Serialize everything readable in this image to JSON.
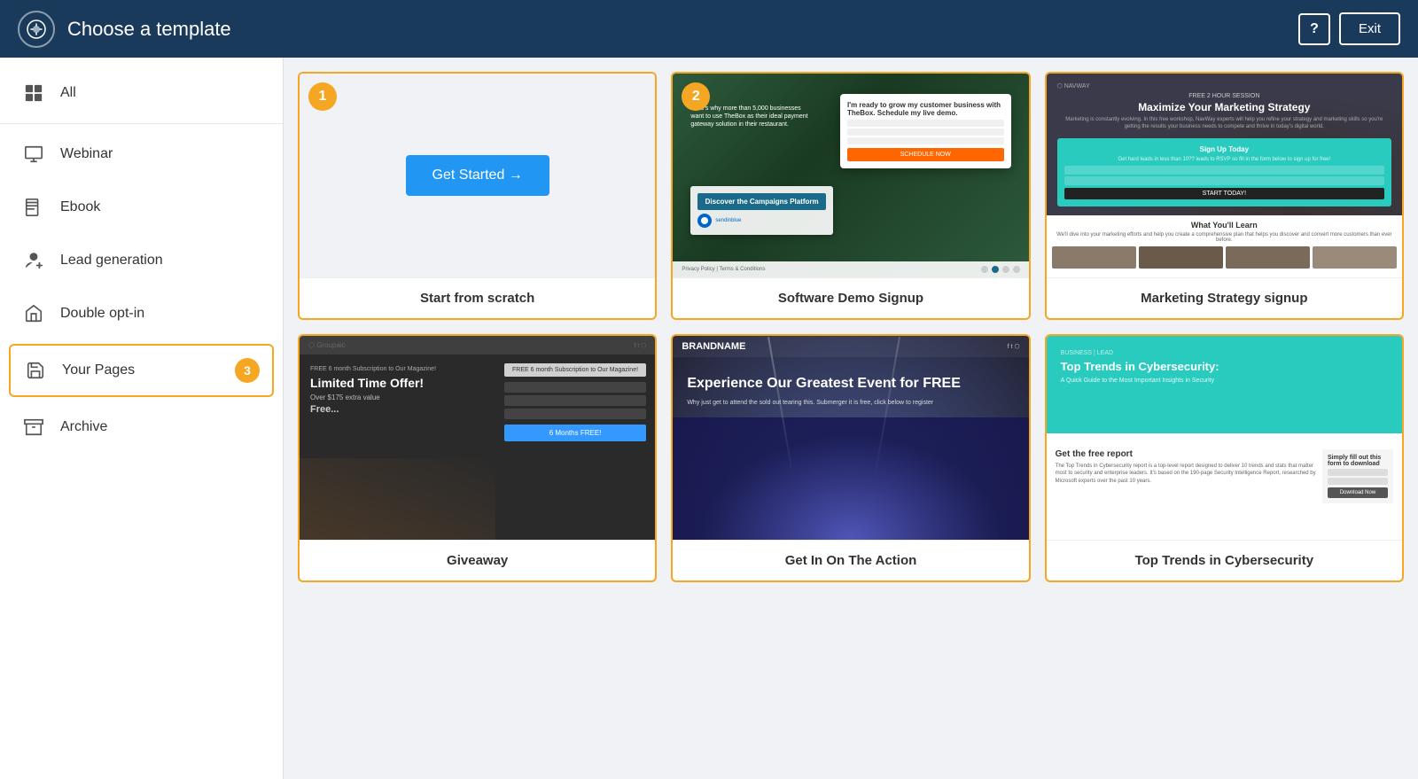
{
  "header": {
    "title": "Choose a template",
    "help_label": "?",
    "exit_label": "Exit",
    "logo_icon": "✦"
  },
  "sidebar": {
    "items": [
      {
        "id": "all",
        "label": "All",
        "icon": "grid",
        "selected": false
      },
      {
        "id": "webinar",
        "label": "Webinar",
        "icon": "monitor",
        "selected": false
      },
      {
        "id": "ebook",
        "label": "Ebook",
        "icon": "book",
        "selected": false
      },
      {
        "id": "lead-generation",
        "label": "Lead generation",
        "icon": "person-add",
        "selected": false
      },
      {
        "id": "double-opt-in",
        "label": "Double opt-in",
        "icon": "inbox",
        "selected": false
      },
      {
        "id": "your-pages",
        "label": "Your Pages",
        "icon": "save",
        "selected": true,
        "badge": "3"
      },
      {
        "id": "archive",
        "label": "Archive",
        "icon": "archive",
        "selected": false
      }
    ]
  },
  "templates": {
    "items": [
      {
        "id": "scratch",
        "label": "Start from scratch",
        "type": "scratch",
        "selected": true,
        "badge": "1",
        "button_label": "Get Started →"
      },
      {
        "id": "software-demo",
        "label": "Software Demo Signup",
        "type": "demo",
        "selected": true,
        "badge": "2"
      },
      {
        "id": "marketing-strategy",
        "label": "Marketing Strategy signup",
        "type": "marketing",
        "selected": true,
        "badge": null
      },
      {
        "id": "giveaway",
        "label": "Giveaway",
        "type": "giveaway",
        "selected": true,
        "badge": null,
        "preview": {
          "offer": "FREE 6 month Subscription to Our Magazine!",
          "title": "Limited Time Offer!",
          "value": "Over $175 extra value",
          "free": "Free..."
        }
      },
      {
        "id": "event",
        "label": "Get In On The Action",
        "type": "event",
        "selected": true,
        "badge": null,
        "preview": {
          "brand": "BRANDNAME",
          "title": "Experience Our Greatest Event for FREE"
        }
      },
      {
        "id": "cybersecurity",
        "label": "Top Trends in Cybersecurity",
        "type": "cyber",
        "selected": true,
        "badge": null,
        "preview": {
          "brand": "BUSINESS | LEAD",
          "title": "Top Trends in Cybersecurity:",
          "subtitle": "A Quick Guide to the Most Important Insights in Security",
          "lower_title": "Get the free report",
          "lower_text": "The Top Trends in Cybersecurity report is a top-level report designed to deliver 10 trends and stats that matter most to security and enterprise leaders. It's based on the 190-page Security Intelligence Report, researched by Microsoft experts over the past 10 years.",
          "download_now": "Download Now"
        }
      }
    ]
  }
}
